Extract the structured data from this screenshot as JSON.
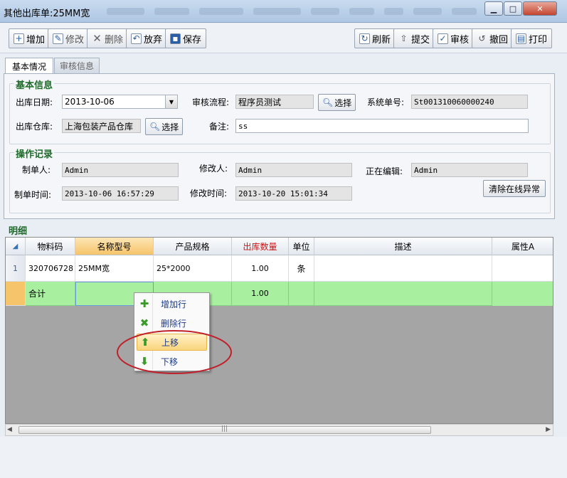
{
  "window": {
    "title": "其他出库单:25MM宽",
    "minimize": "▁",
    "maximize": "□",
    "close": "✕"
  },
  "toolbar": {
    "add": "增加",
    "edit": "修改",
    "delete": "删除",
    "discard": "放弃",
    "save": "保存",
    "refresh": "刷新",
    "submit": "提交",
    "review": "审核",
    "revoke": "撤回",
    "print": "打印"
  },
  "tabs": {
    "basic": "基本情况",
    "review_info": "审核信息"
  },
  "basic": {
    "section_title": "基本信息",
    "date_label": "出库日期:",
    "date_value": "2013-10-06",
    "flow_label": "审核流程:",
    "flow_value": "程序员测试",
    "select": "选择",
    "sysno_label": "系统单号:",
    "sysno_value": "St001310060000240",
    "warehouse_label": "出库仓库:",
    "warehouse_value": "上海包装产品仓库",
    "remark_label": "备注:",
    "remark_value": "ss"
  },
  "oplog": {
    "section_title": "操作记录",
    "creator_label": "制单人:",
    "creator_value": "Admin",
    "modifier_label": "修改人:",
    "modifier_value": "Admin",
    "editing_label": "正在编辑:",
    "editing_value": "Admin",
    "create_time_label": "制单时间:",
    "create_time_value": "2013-10-06 16:57:29",
    "modify_time_label": "修改时间:",
    "modify_time_value": "2013-10-20 15:01:34",
    "clear_button": "清除在线异常"
  },
  "detail": {
    "title": "明细",
    "columns": [
      "物料码",
      "名称型号",
      "产品规格",
      "出库数量",
      "单位",
      "描述",
      "属性A"
    ],
    "rows": [
      {
        "index": "1",
        "code": "320706728",
        "name": "25MM宽",
        "spec": "25*2000",
        "qty": "1.00",
        "unit": "条",
        "desc": "",
        "attr": ""
      }
    ],
    "total": {
      "label": "合计",
      "qty": "1.00"
    }
  },
  "context_menu": {
    "add_row": "增加行",
    "delete_row": "删除行",
    "move_up": "上移",
    "move_down": "下移"
  },
  "colors": {
    "qty_header": "#d01010",
    "total_row": "#a8f0a0",
    "menu_highlight": "#fcd98a",
    "circle": "#c0202a"
  }
}
